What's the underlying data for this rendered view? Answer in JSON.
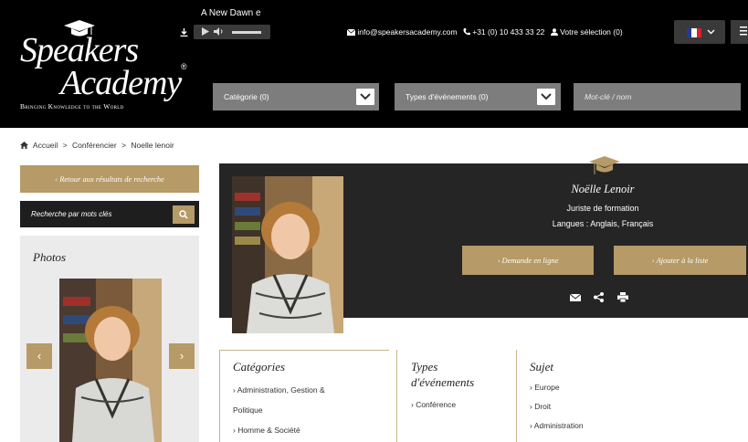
{
  "header": {
    "logo": {
      "line1": "Speakers",
      "line2": "Academy",
      "reg": "®",
      "tagline": "Bringing Knowledge to the World"
    },
    "audio": {
      "title": "A New Dawn e"
    },
    "contact": {
      "email": "info@speakersacademy.com",
      "phone": "+31 (0) 10 433 33 22",
      "selection": "Votre sélection (0)"
    },
    "language_flag": {
      "colors": [
        "#1f3c9c",
        "#ffffff",
        "#d8232a"
      ]
    },
    "filters": {
      "category_label": "Catégorie (0)",
      "event_types_label": "Types d'événements (0)",
      "keyword_placeholder": "Mot-clé / nom"
    }
  },
  "breadcrumb": {
    "items": [
      "Accueil",
      "Conférencier",
      "Noelle lenoir"
    ],
    "separator": ">"
  },
  "sidebar": {
    "back_label": "‹  Retour aux résultats de recherche",
    "keyword_search_label": "Recherche par mots clés",
    "photos_title": "Photos",
    "prev_label": "‹",
    "next_label": "›"
  },
  "profile": {
    "name": "Noëlle Lenoir",
    "role": "Juriste de formation",
    "languages": "Langues : Anglais, Français",
    "demand_label": "›  Demande en ligne",
    "add_label": "›  Ajouter à la liste"
  },
  "info": {
    "categories_title": "Catégories",
    "categories": [
      "›  Administration, Gestion &",
      "Politique",
      "›  Homme & Société"
    ],
    "event_types_title_line1": "Types",
    "event_types_title_line2": "d'événements",
    "event_types": [
      "›  Conférence"
    ],
    "subject_title": "Sujet",
    "subjects": [
      "›  Europe",
      "›  Droit",
      "›  Administration"
    ]
  },
  "colors": {
    "gold": "#b69a67",
    "dark": "#252525",
    "header_bg": "#000000",
    "filter_gray": "#7d7d7d"
  }
}
